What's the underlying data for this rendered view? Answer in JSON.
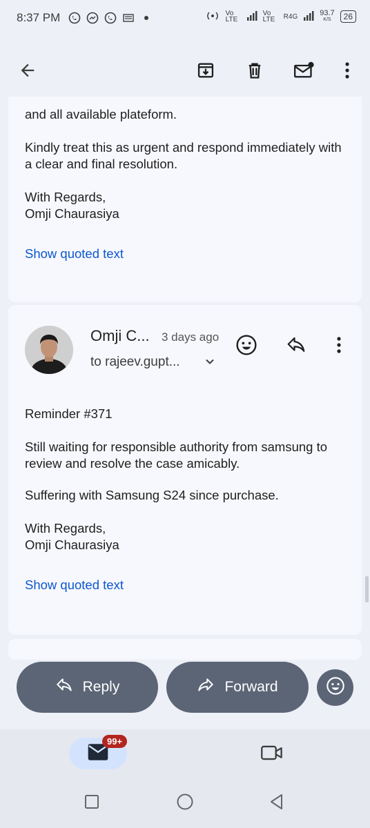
{
  "status": {
    "time": "8:37 PM",
    "net_speed": "93.7",
    "net_unit": "K/S",
    "battery": "26",
    "sim1": "Vo LTE",
    "sim2": "Vo LTE",
    "net_type": "R4G"
  },
  "toolbar": {
    "icons": [
      "back-arrow-icon",
      "archive-icon",
      "delete-icon",
      "mark-unread-icon",
      "more-vert-icon"
    ]
  },
  "messages": [
    {
      "partial_line": "and all available plateform.",
      "paragraphs": [
        "Kindly treat this as urgent and respond immediately with a clear and final resolution.",
        "With Regards,",
        "Omji Chaurasiya"
      ],
      "show_quoted": "Show quoted text"
    },
    {
      "sender": "Omji C...",
      "date": "3 days ago",
      "to": "to rajeev.gupt...",
      "paragraphs": [
        "Reminder #371",
        "Still waiting for responsible authority from samsung to review and resolve the case amicably.",
        "Suffering with Samsung S24 since purchase.",
        "With Regards,",
        "Omji Chaurasiya"
      ],
      "show_quoted": "Show quoted text"
    }
  ],
  "actions": {
    "reply": "Reply",
    "forward": "Forward"
  },
  "bottom_nav": {
    "mail_badge": "99+"
  },
  "colors": {
    "accent_link": "#0b57d0",
    "pill_bg": "#5b6576",
    "badge_bg": "#b3261e",
    "background": "#eef0f7"
  }
}
